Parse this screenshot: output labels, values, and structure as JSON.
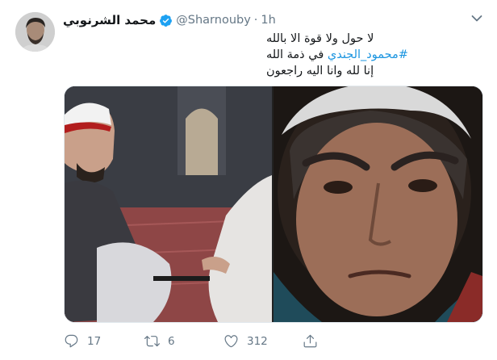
{
  "tweet": {
    "author": {
      "display_name": "محمد الشرنوبي",
      "handle": "@Sharnouby",
      "verified": true
    },
    "separator": "·",
    "time": "1h",
    "text": {
      "line1": "لا حول ولا قوة الا بالله",
      "hashtag": "#محمود_الجندي",
      "line2_rest": " في ذمة الله",
      "line3": "إنا لله وانا اليه راجعون"
    },
    "media": {
      "items": [
        {
          "alt": "mosque-scene-photo"
        },
        {
          "alt": "portrait-photo"
        }
      ]
    },
    "actions": {
      "replies": "17",
      "retweets": "6",
      "likes": "312"
    },
    "colors": {
      "link": "#1b95e0",
      "verified_badge": "#1da1f2",
      "muted": "#657786"
    }
  }
}
